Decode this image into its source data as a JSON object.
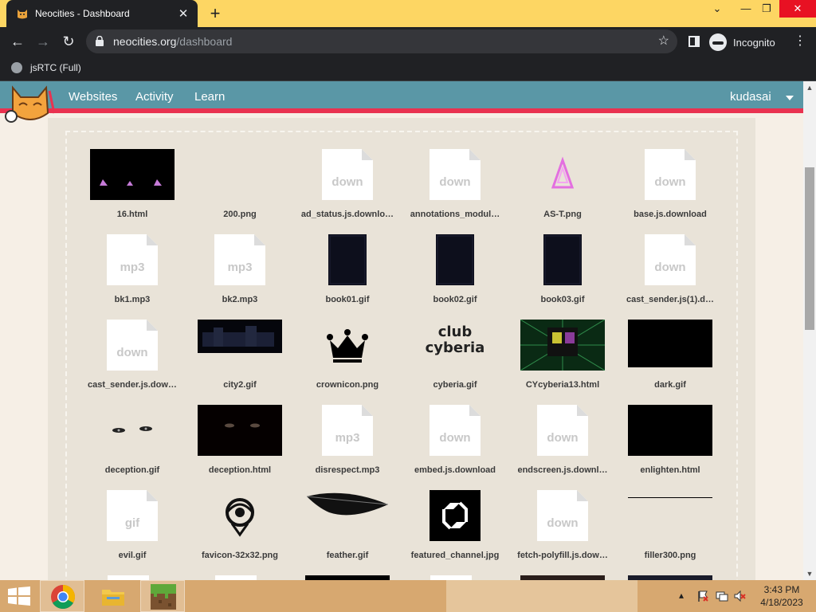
{
  "browser": {
    "tab_title": "Neocities - Dashboard",
    "tab_close": "✕",
    "new_tab": "+",
    "url_host": "neocities.org",
    "url_path": "/dashboard",
    "incognito_label": "Incognito",
    "bookmark": "jsRTC (Full)",
    "window_controls": {
      "chevron": "⌄",
      "minimize": "—",
      "restore": "❐",
      "close": "✕"
    },
    "nav": {
      "back": "←",
      "forward": "→",
      "reload": "↻",
      "star": "☆",
      "kebab": "⋮"
    }
  },
  "site": {
    "nav_links": [
      "Websites",
      "Activity",
      "Learn"
    ],
    "username": "kudasai",
    "accent_color": "#5a97a6",
    "stripe_color": "#e93250"
  },
  "files": [
    {
      "name": "16.html"
    },
    {
      "name": "200.png"
    },
    {
      "name": "ad_status.js.downlo…",
      "icon": "down"
    },
    {
      "name": "annotations_modul…",
      "icon": "down"
    },
    {
      "name": "AS-T.png"
    },
    {
      "name": "base.js.download",
      "icon": "down"
    },
    {
      "name": "bk1.mp3",
      "icon": "mp3"
    },
    {
      "name": "bk2.mp3",
      "icon": "mp3"
    },
    {
      "name": "book01.gif"
    },
    {
      "name": "book02.gif"
    },
    {
      "name": "book03.gif"
    },
    {
      "name": "cast_sender.js(1).d…",
      "icon": "down"
    },
    {
      "name": "cast_sender.js.dow…",
      "icon": "down"
    },
    {
      "name": "city2.gif"
    },
    {
      "name": "crownicon.png"
    },
    {
      "name": "cyberia.gif",
      "text": "club cyberia"
    },
    {
      "name": "CYcyberia13.html"
    },
    {
      "name": "dark.gif"
    },
    {
      "name": "deception.gif"
    },
    {
      "name": "deception.html"
    },
    {
      "name": "disrespect.mp3",
      "icon": "mp3"
    },
    {
      "name": "embed.js.download",
      "icon": "down"
    },
    {
      "name": "endscreen.js.downl…",
      "icon": "down"
    },
    {
      "name": "enlighten.html"
    },
    {
      "name": "evil.gif",
      "icon": "gif"
    },
    {
      "name": "favicon-32x32.png"
    },
    {
      "name": "feather.gif"
    },
    {
      "name": "featured_channel.jpg"
    },
    {
      "name": "fetch-polyfill.js.dow…",
      "icon": "down"
    },
    {
      "name": "filler300.png"
    }
  ],
  "taskbar": {
    "time": "3:43 PM",
    "date": "4/18/2023",
    "tray_icons": [
      "chevron-up-icon",
      "flag-icon",
      "network-icon",
      "volume-muted-icon"
    ]
  }
}
